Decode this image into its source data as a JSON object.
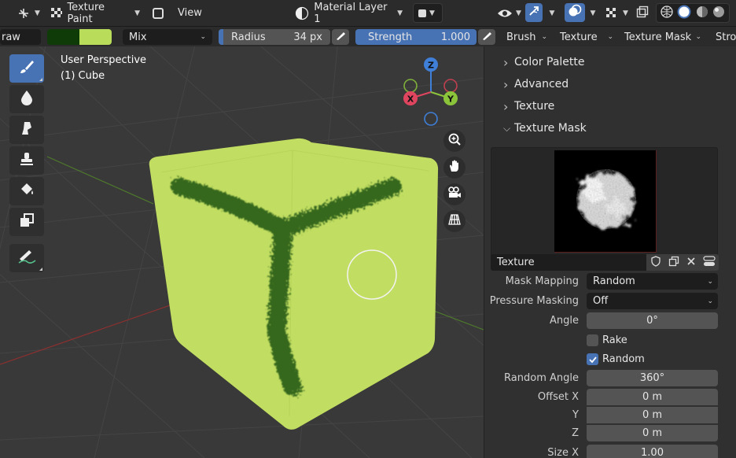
{
  "header": {
    "mode_label": "Texture Paint",
    "view_menu": "View",
    "material_slot": "Material Layer 1"
  },
  "tool_settings": {
    "tool_name_partial": "raw",
    "blend_mode": "Mix",
    "radius_label": "Radius",
    "radius_value": "34 px",
    "strength_label": "Strength",
    "strength_value": "1.000",
    "brush_menu": "Brush",
    "texture_menu": "Texture",
    "texture_mask_menu": "Texture Mask",
    "stroke_menu_partial": "Stro",
    "colors": {
      "secondary": "#0f3b08",
      "primary": "#b9dc5a"
    }
  },
  "viewport": {
    "view_name": "User Perspective",
    "object_name": "(1) Cube",
    "gizmo": {
      "z": "Z",
      "x": "X",
      "y": "Y"
    },
    "cube_color": "#c2de62",
    "stroke_color": "#36681e"
  },
  "panel": {
    "sections": [
      {
        "label": "Color Palette",
        "expanded": false
      },
      {
        "label": "Advanced",
        "expanded": false
      },
      {
        "label": "Texture",
        "expanded": false
      },
      {
        "label": "Texture Mask",
        "expanded": true
      }
    ],
    "texture_name": "Texture",
    "mask_mapping": {
      "label": "Mask Mapping",
      "value": "Random"
    },
    "pressure_masking": {
      "label": "Pressure Masking",
      "value": "Off"
    },
    "angle": {
      "label": "Angle",
      "value": "0°"
    },
    "rake": {
      "label": "Rake",
      "checked": false
    },
    "random": {
      "label": "Random",
      "checked": true
    },
    "random_angle": {
      "label": "Random Angle",
      "value": "360°"
    },
    "offset_x": {
      "label": "Offset X",
      "value": "0 m"
    },
    "offset_y": {
      "label": "Y",
      "value": "0 m"
    },
    "offset_z": {
      "label": "Z",
      "value": "0 m"
    },
    "size_x": {
      "label": "Size X",
      "value": "1.00"
    }
  },
  "accent_color": "#4772b3"
}
